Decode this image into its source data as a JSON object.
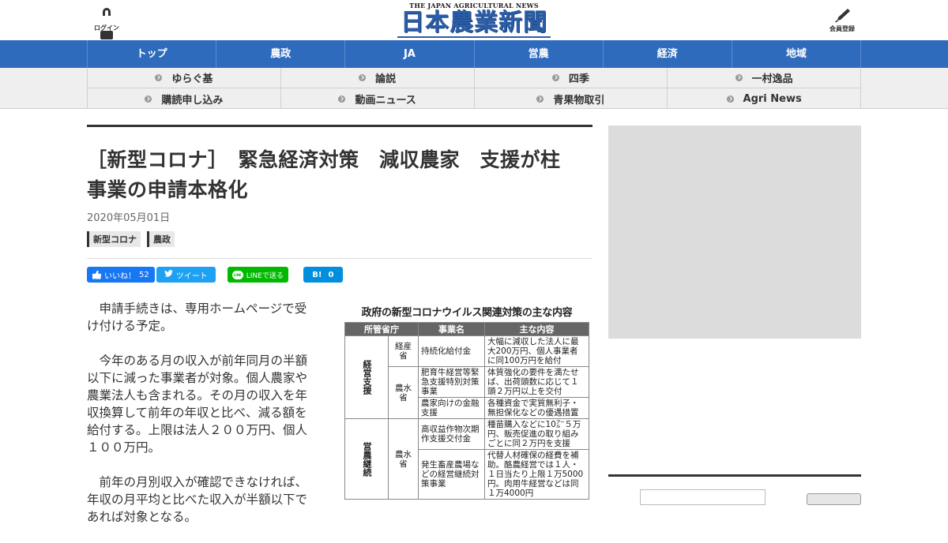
{
  "header": {
    "login_label": "ログイン",
    "member_label": "会員登録",
    "logo_sub": "THE JAPAN AGRICULTURAL NEWS",
    "logo_main": "日本農業新聞"
  },
  "main_nav": [
    "トップ",
    "農政",
    "JA",
    "営農",
    "経済",
    "地域"
  ],
  "sub_nav": [
    "ゆらぐ基",
    "論説",
    "四季",
    "一村逸品",
    "購読申し込み",
    "動画ニュース",
    "青果物取引",
    "Agri News"
  ],
  "article": {
    "title": "［新型コロナ］　緊急経済対策　減収農家　支援が柱　事業の申請本格化",
    "date": "2020年05月01日",
    "tags": [
      "新型コロナ",
      "農政"
    ],
    "paragraphs": [
      "申請手続きは、専用ホームページで受け付ける予定。",
      "今年のある月の収入が前年同月の半額以下に減った事業者が対象。個人農家や農業法人も含まれる。その月の収入を年収換算して前年の年収と比べ、減る額を給付する。上限は法人２００万円、個人１００万円。",
      "前年の月別収入が確認できなければ、年収の月平均と比べた収入が半額以下であれば対象となる。"
    ]
  },
  "share": {
    "fb_label": "いいね！",
    "fb_count": "52",
    "tw_label": "ツイート",
    "line_label": "LINEで送る",
    "line_icon_text": "LINE",
    "hb_label": "B!",
    "hb_count": "0"
  },
  "figure": {
    "title": "政府の新型コロナウイルス関連対策の主な内容",
    "headers": [
      "所管省庁",
      "事業名",
      "主な内容"
    ],
    "categories": [
      "経営支援",
      "営農継続"
    ],
    "rows": [
      {
        "ministry": "経産省",
        "name": "持続化給付金",
        "content": "大幅に減収した法人に最大200万円、個人事業者に同100万円を給付"
      },
      {
        "ministry": "農水省",
        "name": "肥育牛経営等緊急支援特別対策事業",
        "content": "体質強化の要件を満たせば、出荷頭数に応じて１頭２万円以上を交付"
      },
      {
        "ministry": "",
        "name": "農家向けの金融支援",
        "content": "各種資金で実質無利子・無担保化などの優遇措置"
      },
      {
        "ministry": "農水省",
        "name": "高収益作物次期作支援交付金",
        "content": "種苗購入などに10㌃５万円、販売促進の取り組みごとに同２万円を支援"
      },
      {
        "ministry": "",
        "name": "発生畜産農場などの経営継続対策事業",
        "content": "代替人材確保の経費を補助。酪農経営では１人・１日当たり上限１万5000円。肉用牛経営などは同１万4000円"
      }
    ]
  }
}
